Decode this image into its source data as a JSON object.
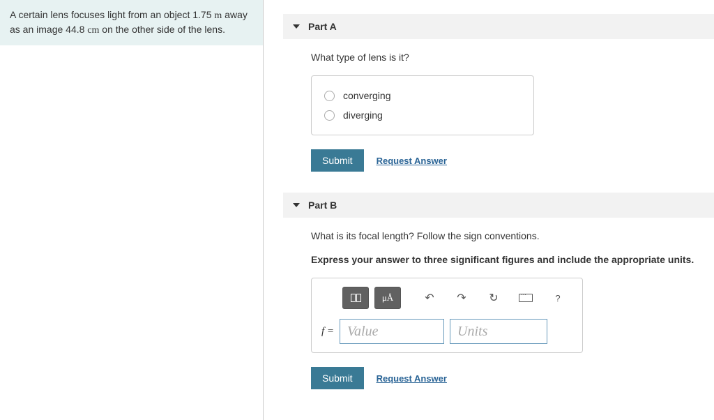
{
  "problem": {
    "text_parts": [
      "A certain lens focuses light from an object 1.75 ",
      "m",
      " away as an image 44.8 ",
      "cm",
      " on the other side of the lens."
    ]
  },
  "partA": {
    "title": "Part A",
    "question": "What type of lens is it?",
    "options": [
      "converging",
      "diverging"
    ],
    "submit": "Submit",
    "request": "Request Answer"
  },
  "partB": {
    "title": "Part B",
    "question": "What is its focal length? Follow the sign conventions.",
    "instruction": "Express your answer to three significant figures and include the appropriate units.",
    "var_label": "f =",
    "value_placeholder": "Value",
    "units_placeholder": "Units",
    "mu_label": "μÅ",
    "help": "?",
    "submit": "Submit",
    "request": "Request Answer"
  }
}
